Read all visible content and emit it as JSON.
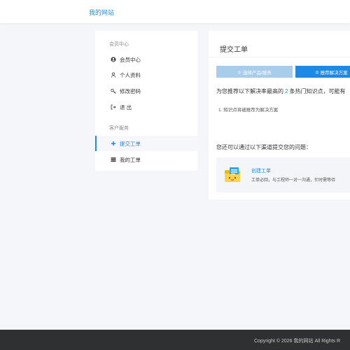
{
  "header": {
    "brand": "我的网站"
  },
  "sidebar": {
    "groups": [
      {
        "title": "会员中心",
        "items": [
          {
            "label": "会员中心",
            "icon": "user-circle-icon"
          },
          {
            "label": "个人资料",
            "icon": "user-icon"
          },
          {
            "label": "修改密码",
            "icon": "key-icon"
          },
          {
            "label": "退 出",
            "icon": "sign-out-icon"
          }
        ]
      },
      {
        "title": "客户服务",
        "items": [
          {
            "label": "提交工单",
            "icon": "plus-icon",
            "active": true
          },
          {
            "label": "我的工单",
            "icon": "list-icon"
          }
        ]
      }
    ]
  },
  "main": {
    "title": "提交工单",
    "steps": [
      {
        "label": "① 选择产品/服务"
      },
      {
        "label": "② 推荐解决方案",
        "active": true
      }
    ],
    "recommend": {
      "prefix": "为您推荐以下解决率最高的",
      "count": "2",
      "suffix": "条热门知识点，可能有"
    },
    "kb_items": [
      "1. 知识点将被推荐为解决方案"
    ],
    "channels_text": "您还可以通过以下渠道提交您的问题：",
    "card": {
      "title": "创建工单",
      "desc": "工单必回，与工程师一对一沟通，忙时需等待",
      "icon": "ticket-folder-icon"
    }
  },
  "footer": {
    "copyright": "Copyright © 2026 我的网站 All Rights R"
  },
  "colors": {
    "accent": "#1e88e5",
    "accent_light": "#a8cdea",
    "footer_bg": "#2f3031"
  }
}
